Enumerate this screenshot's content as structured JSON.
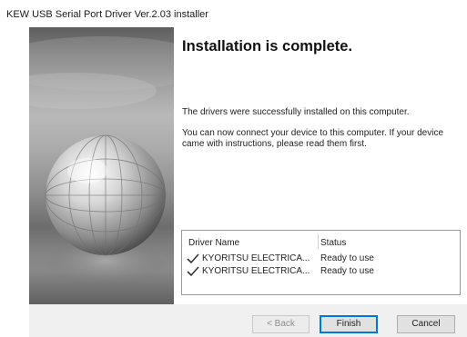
{
  "window": {
    "title": "KEW USB Serial Port Driver Ver.2.03 installer"
  },
  "sidebar": {
    "image": "globe-graphic"
  },
  "main": {
    "heading": "Installation is complete.",
    "message1": "The drivers were successfully installed on this computer.",
    "message2": "You can now connect your device to this computer. If your device came with instructions, please read them first."
  },
  "driver_list": {
    "columns": [
      "Driver Name",
      "Status"
    ],
    "rows": [
      {
        "name": "KYORITSU ELECTRICA...",
        "status": "Ready to use",
        "icon": "checkmark-icon"
      },
      {
        "name": "KYORITSU ELECTRICA...",
        "status": "Ready to use",
        "icon": "checkmark-icon"
      }
    ]
  },
  "buttons": {
    "back": "< Back",
    "finish": "Finish",
    "cancel": "Cancel"
  },
  "colors": {
    "focus_border": "#0078d7",
    "footer_bg": "#f0f0f0"
  }
}
